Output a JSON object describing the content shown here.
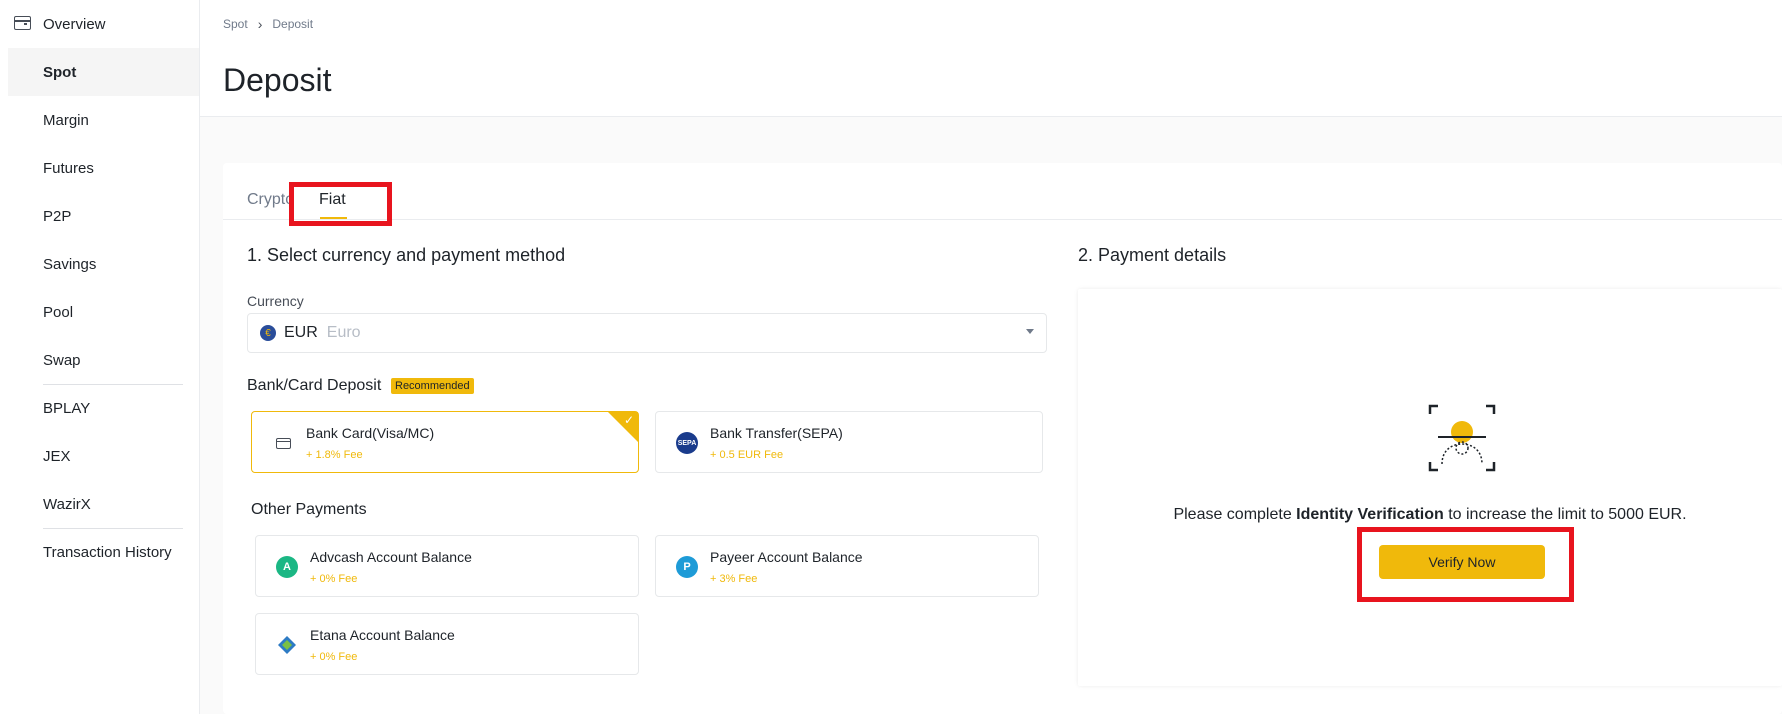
{
  "sidebar": {
    "items": [
      {
        "label": "Overview"
      },
      {
        "label": "Spot"
      },
      {
        "label": "Margin"
      },
      {
        "label": "Futures"
      },
      {
        "label": "P2P"
      },
      {
        "label": "Savings"
      },
      {
        "label": "Pool"
      },
      {
        "label": "Swap"
      },
      {
        "label": "BPLAY"
      },
      {
        "label": "JEX"
      },
      {
        "label": "WazirX"
      },
      {
        "label": "Transaction History"
      }
    ],
    "active": "Spot"
  },
  "breadcrumb": {
    "items": [
      "Spot",
      "Deposit"
    ],
    "separator": "›"
  },
  "page_title": "Deposit",
  "tabs": [
    {
      "label": "Crypto",
      "active": false
    },
    {
      "label": "Fiat",
      "active": true
    }
  ],
  "section1": {
    "title": "1. Select currency and payment method",
    "currency_label": "Currency",
    "currency": {
      "code": "EUR",
      "name": "Euro",
      "icon": "€"
    },
    "bank_card_title": "Bank/Card Deposit",
    "recommended_badge": "Recommended",
    "bank_methods": [
      {
        "name": "Bank Card(Visa/MC)",
        "fee": "+ 1.8% Fee",
        "icon": "card-icon",
        "selected": true
      },
      {
        "name": "Bank Transfer(SEPA)",
        "fee": "+ 0.5 EUR Fee",
        "icon": "sepa-icon",
        "icon_text": "SEPA",
        "selected": false
      }
    ],
    "other_title": "Other Payments",
    "other_methods": [
      {
        "name": "Advcash Account Balance",
        "fee": "+ 0% Fee",
        "icon": "advcash-icon",
        "icon_text": "A"
      },
      {
        "name": "Payeer Account Balance",
        "fee": "+ 3% Fee",
        "icon": "payeer-icon",
        "icon_text": "P"
      },
      {
        "name": "Etana Account Balance",
        "fee": "+ 0% Fee",
        "icon": "etana-icon"
      }
    ]
  },
  "section2": {
    "title": "2. Payment details",
    "verify_prefix": "Please complete ",
    "verify_bold": "Identity Verification",
    "verify_suffix": " to increase the limit to 5000 EUR.",
    "verify_button": "Verify Now"
  },
  "colors": {
    "accent": "#F0B90B",
    "highlight_box": "#E8141E",
    "advcash": "#1BB784",
    "payeer": "#1E9BD7",
    "sepa": "#1A3B8C"
  }
}
